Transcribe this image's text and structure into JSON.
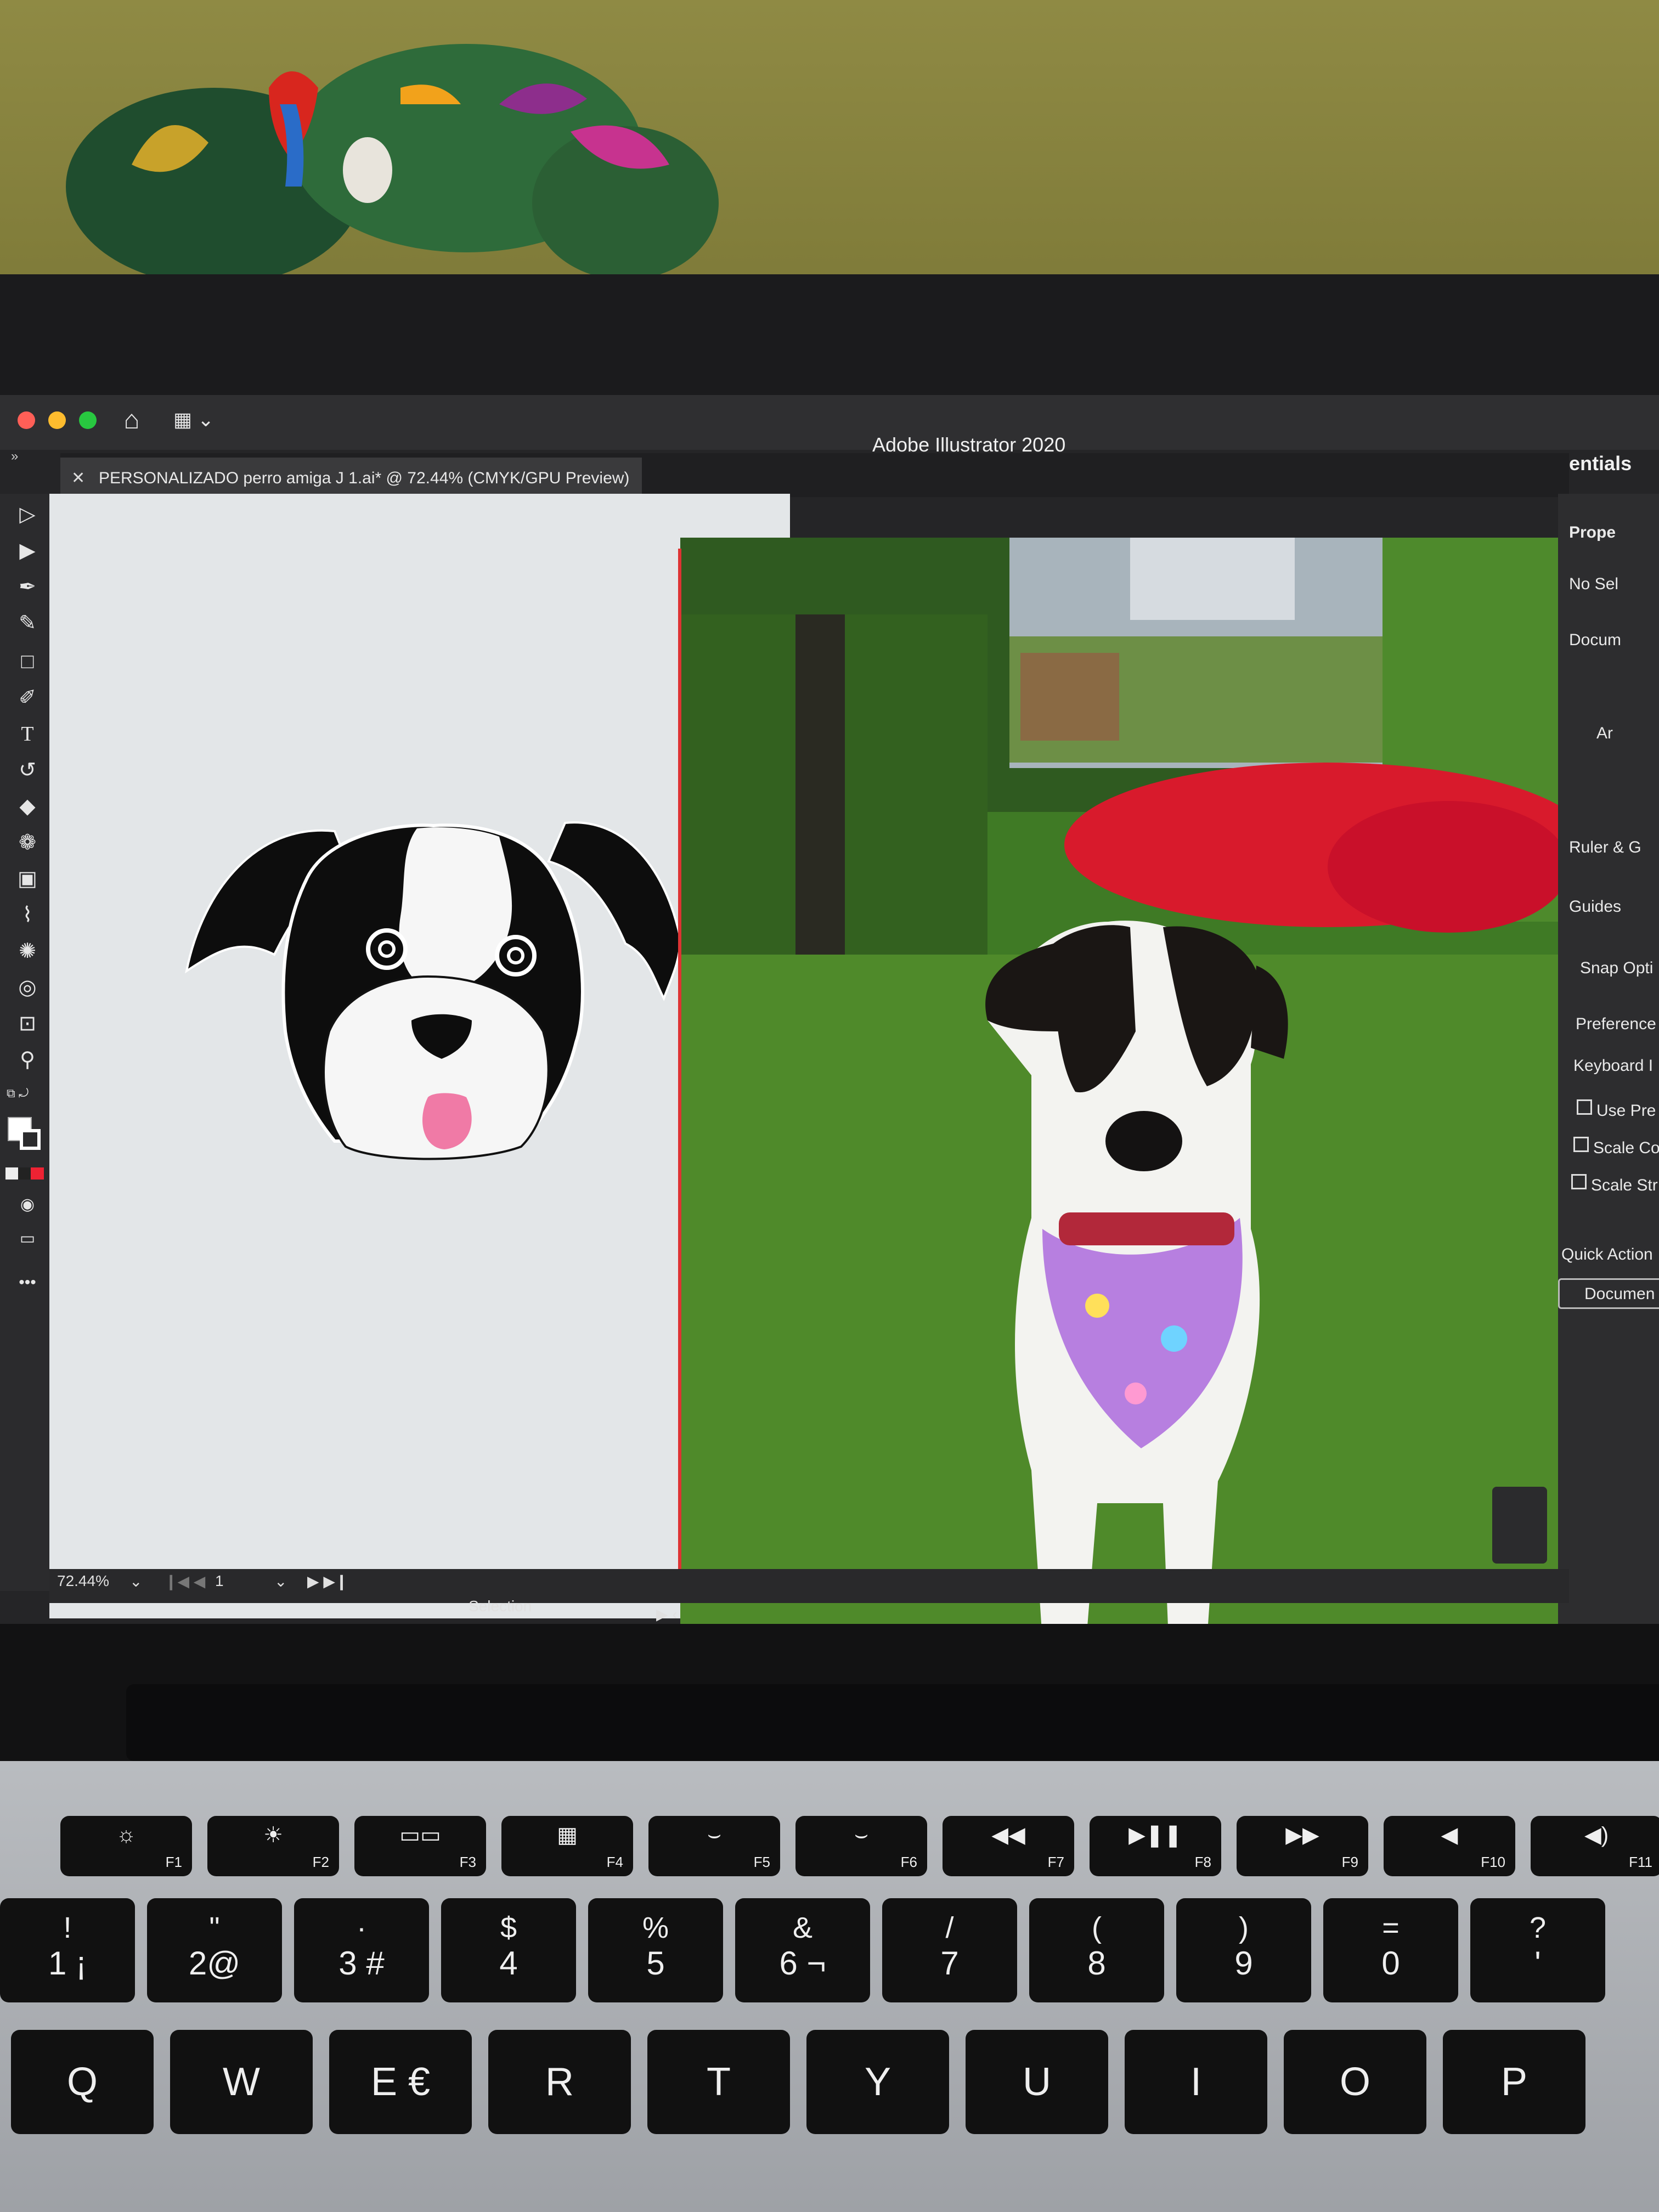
{
  "window": {
    "title": "Adobe Illustrator 2020",
    "workspace": "Essentials",
    "document_tab": "PERSONALIZADO perro amiga J 1.ai* @ 72.44% (CMYK/GPU Preview)"
  },
  "status_bar": {
    "zoom": "72.44%",
    "artboard_number": "1",
    "tool_name": "Selection"
  },
  "properties_panel": {
    "title": "Prope",
    "selection": "No Sel",
    "document_section": "Docum",
    "artboard_section": "Ar",
    "ruler_grids": "Ruler & G",
    "guides": "Guides",
    "snap_options": "Snap Opti",
    "preferences": "Preference",
    "keyboard": "Keyboard I",
    "use_preview": "Use Pre",
    "scale_corners": "Scale Co",
    "scale_strokes": "Scale Str",
    "quick_actions": "Quick Action",
    "document_setup_button": "Documen"
  },
  "function_keys": [
    {
      "label": "F1",
      "icon": "brightness-low-icon",
      "glyph": "☼"
    },
    {
      "label": "F2",
      "icon": "brightness-high-icon",
      "glyph": "☀"
    },
    {
      "label": "F3",
      "icon": "mission-control-icon",
      "glyph": "▭▭"
    },
    {
      "label": "F4",
      "icon": "launchpad-icon",
      "glyph": "▦"
    },
    {
      "label": "F5",
      "icon": "keyboard-light-low-icon",
      "glyph": "⌣"
    },
    {
      "label": "F6",
      "icon": "keyboard-light-high-icon",
      "glyph": "⌣"
    },
    {
      "label": "F7",
      "icon": "rewind-icon",
      "glyph": "◀◀"
    },
    {
      "label": "F8",
      "icon": "play-pause-icon",
      "glyph": "▶❚❚"
    },
    {
      "label": "F9",
      "icon": "fast-forward-icon",
      "glyph": "▶▶"
    },
    {
      "label": "F10",
      "icon": "mute-icon",
      "glyph": "◀"
    },
    {
      "label": "F11",
      "icon": "volume-down-icon",
      "glyph": "◀)"
    }
  ],
  "number_keys": [
    {
      "top": "!",
      "bottom": "1 ¡"
    },
    {
      "top": "\"",
      "bottom": "2@"
    },
    {
      "top": "·",
      "bottom": "3 #"
    },
    {
      "top": "$",
      "bottom": "4"
    },
    {
      "top": "%",
      "bottom": "5"
    },
    {
      "top": "&",
      "bottom": "6 ¬"
    },
    {
      "top": "/",
      "bottom": "7"
    },
    {
      "top": "(",
      "bottom": "8"
    },
    {
      "top": ")",
      "bottom": "9"
    },
    {
      "top": "=",
      "bottom": "0"
    },
    {
      "top": "?",
      "bottom": "'"
    }
  ],
  "letter_keys": [
    "Q",
    "W",
    "E €",
    "R",
    "T",
    "Y",
    "U",
    "I",
    "O",
    "P"
  ],
  "colors": {
    "ui_dark": "#2f2f31",
    "artboard": "#e3e6e8",
    "tongue_pink": "#f07aa6",
    "bandana_purple": "#b77fe0",
    "grass_green": "#4f8a2a",
    "flowers_red": "#e0142a"
  }
}
